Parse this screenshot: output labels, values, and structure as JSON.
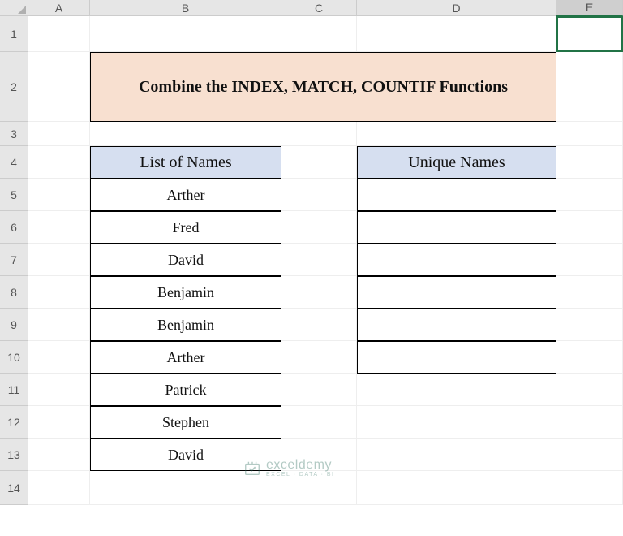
{
  "columns": [
    "A",
    "B",
    "C",
    "D",
    "E"
  ],
  "rows": [
    "1",
    "2",
    "3",
    "4",
    "5",
    "6",
    "7",
    "8",
    "9",
    "10",
    "11",
    "12",
    "13",
    "14"
  ],
  "title": "Combine the INDEX, MATCH, COUNTIF Functions",
  "list_header": "List of Names",
  "unique_header": "Unique Names",
  "names": [
    "Arther",
    "Fred",
    "David",
    "Benjamin",
    "Benjamin",
    "Arther",
    "Patrick",
    "Stephen",
    "David"
  ],
  "unique_cells": [
    "",
    "",
    "",
    "",
    "",
    ""
  ],
  "selected_column": "E",
  "watermark": {
    "brand": "exceldemy",
    "tag": "EXCEL · DATA · BI"
  }
}
